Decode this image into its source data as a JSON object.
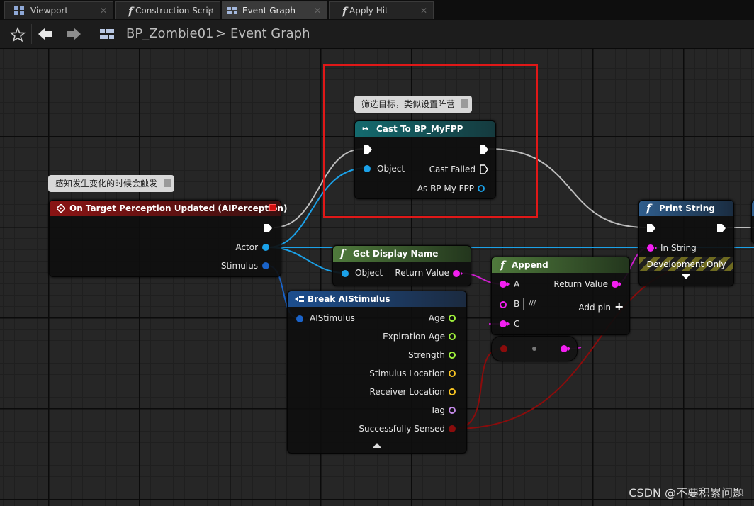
{
  "tabs": [
    {
      "label": "Viewport",
      "icon": "viewport-icon"
    },
    {
      "label": "Construction Scrip",
      "icon": "function-icon"
    },
    {
      "label": "Event Graph",
      "icon": "event-graph-icon"
    },
    {
      "label": "Apply Hit",
      "icon": "function-icon"
    }
  ],
  "breadcrumb": {
    "blueprint": "BP_Zombie01",
    "separator": ">",
    "graph": "Event Graph"
  },
  "comments": {
    "cast": "筛选目标，类似设置阵营",
    "event": "感知发生变化的时候会触发"
  },
  "nodes": {
    "event": {
      "title": "On Target Perception Updated (AIPerception)",
      "pins": [
        "Actor",
        "Stimulus"
      ]
    },
    "cast": {
      "title": "Cast To BP_MyFPP",
      "pins": [
        "Object",
        "Cast Failed",
        "As BP My FPP"
      ]
    },
    "get_name": {
      "title": "Get Display Name",
      "pins": [
        "Object",
        "Return Value"
      ]
    },
    "append": {
      "title": "Append",
      "pins": [
        "A",
        "B",
        "C",
        "Return Value",
        "Add pin"
      ],
      "b_value": "///"
    },
    "print": {
      "title": "Print String",
      "pins": [
        "In String"
      ],
      "dev_only": "Development Only"
    },
    "break": {
      "title": "Break AIStimulus",
      "pins": [
        "AIStimulus",
        "Age",
        "Expiration Age",
        "Strength",
        "Stimulus Location",
        "Receiver Location",
        "Tag",
        "Successfully Sensed"
      ]
    }
  },
  "colors": {
    "object": "#1ba1e8",
    "string": "#f31ff1",
    "float": "#9ef03c",
    "vector": "#f6c222",
    "name": "#c48ae8",
    "bool": "#8a0c0c",
    "highlight": "#e01818"
  },
  "watermark": "CSDN @不要积累问题"
}
